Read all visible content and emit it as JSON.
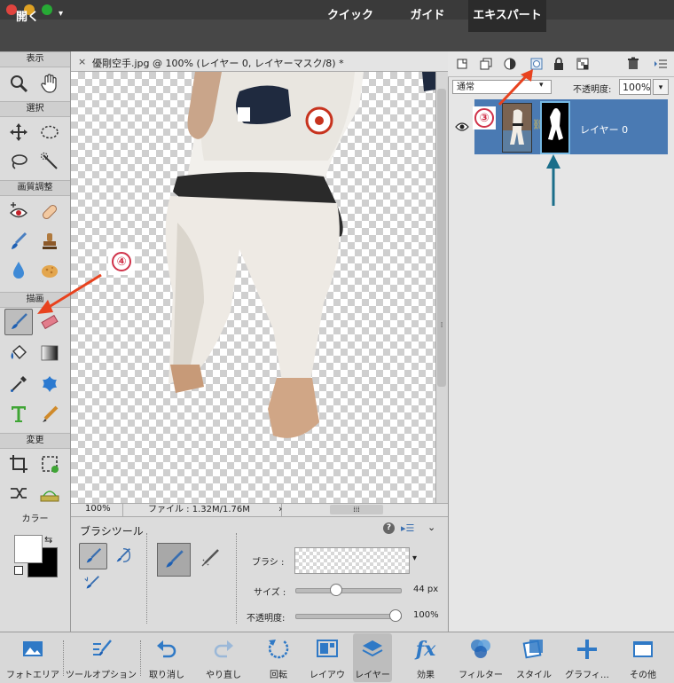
{
  "topbar": {
    "open_label": "開く",
    "open_arrow": "▾",
    "modes": [
      "クイック",
      "ガイド",
      "エキスパート"
    ],
    "active_mode": "エキスパート"
  },
  "toolbox": {
    "sections": {
      "view": "表示",
      "select": "選択",
      "enhance": "画質調整",
      "draw": "描画",
      "modify": "変更",
      "color": "カラー"
    }
  },
  "document": {
    "close_glyph": "×",
    "title": "優剛空手.jpg @ 100% (レイヤー 0, レイヤーマスク/8) *",
    "zoom": "100%",
    "file_info": "ファイル : 1.32M/1.76M",
    "status_arrow": "›"
  },
  "layers_panel": {
    "blend_mode": "通常",
    "blend_arrow": "▾",
    "opacity_label": "不透明度:",
    "opacity_value": "100%",
    "opacity_arrow": "▾",
    "layer_name": "レイヤー 0"
  },
  "tool_options": {
    "title": "ブラシツール",
    "help_glyph": "?",
    "brush_label": "ブラシ :",
    "brush_arrow": "▾",
    "size_label": "サイズ :",
    "size_value": "44 px",
    "size_fraction": 0.37,
    "opacity_label": "不透明度:",
    "opacity_value": "100%",
    "opacity_fraction": 1.0
  },
  "taskbar": {
    "items": [
      "フォトエリア",
      "ツールオプション",
      "取り消し",
      "やり直し",
      "回転",
      "レイアウ",
      "レイヤー",
      "効果",
      "フィルター",
      "スタイル",
      "グラフィ…",
      "その他"
    ],
    "active": "レイヤー",
    "fx_glyph": "fx"
  },
  "annotations": {
    "three": "③",
    "four": "④"
  },
  "colors": {
    "accent_selection": "#4a7ab3",
    "annotation_red": "#e8421e",
    "annotation_teal": "#1b6e8a"
  }
}
